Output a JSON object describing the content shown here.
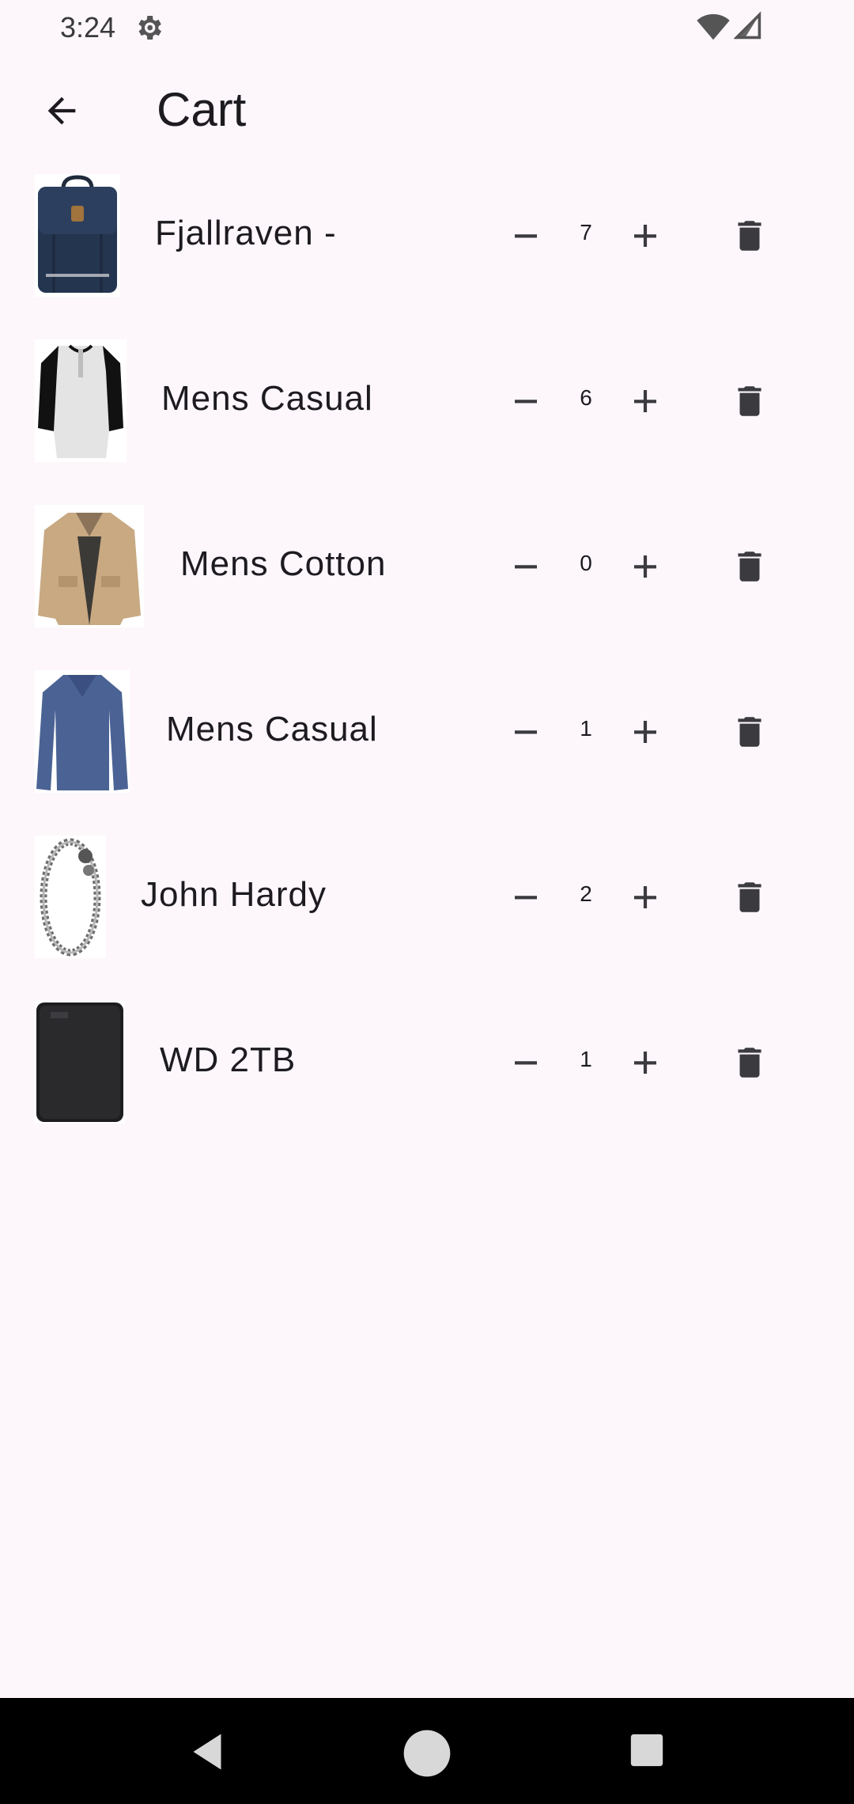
{
  "status_bar": {
    "time": "3:24",
    "icons": [
      "gear-icon",
      "wifi-icon",
      "signal-icon"
    ]
  },
  "app_bar": {
    "title": "Cart",
    "back_icon": "arrow-back-icon"
  },
  "cart": {
    "items": [
      {
        "name": "Fjallraven -",
        "quantity": "7",
        "image": "backpack"
      },
      {
        "name": "Mens Casual",
        "quantity": "6",
        "image": "raglan-shirt"
      },
      {
        "name": "Mens Cotton",
        "quantity": "0",
        "image": "cotton-jacket"
      },
      {
        "name": "Mens Casual",
        "quantity": "1",
        "image": "blue-longsleeve"
      },
      {
        "name": "John Hardy",
        "quantity": "2",
        "image": "silver-bracelet"
      },
      {
        "name": "WD 2TB",
        "quantity": "1",
        "image": "hard-drive"
      }
    ]
  },
  "nav_bar": {
    "icons": [
      "nav-back-icon",
      "nav-home-icon",
      "nav-recents-icon"
    ]
  },
  "colors": {
    "background": "#fdf7fc",
    "text": "#1d1b20",
    "icon": "#3b3a3e",
    "nav_bar": "#000000"
  }
}
